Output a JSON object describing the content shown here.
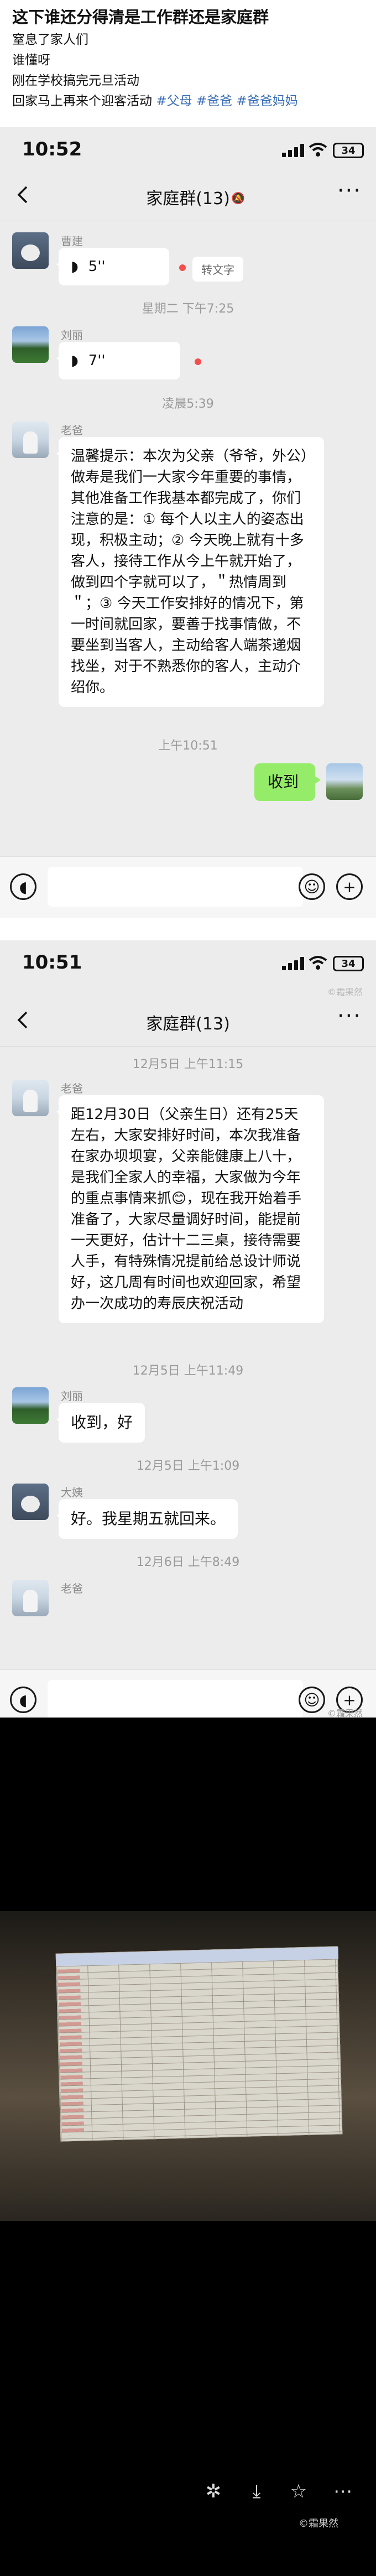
{
  "post": {
    "title": "这下谁还分得清是工作群还是家庭群",
    "lines": [
      "窒息了家人们",
      "谁懂呀",
      "刚在学校搞完元旦活动"
    ],
    "last_line_text": "回家马上再来个迎客活动 ",
    "tags": [
      "#父母",
      "#爸爸",
      "#爸爸妈妈"
    ]
  },
  "shot1": {
    "time": "10:52",
    "battery": "34",
    "chat_title": "家庭群(13)",
    "mute_icon": "🔕",
    "msg1": {
      "sender": "曹建",
      "duration": "5''",
      "to_text": "转文字"
    },
    "msg2": {
      "sender": "刘丽",
      "duration": "7''"
    },
    "ts1": "星期二 下午7:25",
    "ts2": "凌晨5:39",
    "msg3": {
      "sender": "老爸",
      "text": "温馨提示：本次为父亲（爷爷，外公）做寿是我们一大家今年重要的事情，其他准备工作我基本都完成了，你们注意的是：① 每个人以主人的姿态出现，积极主动；② 今天晚上就有十多客人，接待工作从今上午就开始了，做到四个字就可以了，＂热情周到＂；③ 今天工作安排好的情况下，第一时间就回家，要善于找事情做，不要坐到当客人，主动给客人端茶递烟找坐，对于不熟悉你的客人，主动介绍你。"
    },
    "ts3": "上午10:51",
    "msg4": {
      "text": "收到"
    }
  },
  "shot2": {
    "time": "10:51",
    "battery": "34",
    "chat_title": "家庭群(13)",
    "ts1": "12月5日 上午11:15",
    "msg1": {
      "sender": "老爸",
      "text": "距12月30日（父亲生日）还有25天左右，大家安排好时间，本次我准备在家办坝坝宴，父亲能健康上八十，是我们全家人的幸福，大家做为今年的重点事情来抓😊，现在我开始着手准备了，大家尽量调好时间，能提前一天更好，估计十二三桌，接待需要人手，有特殊情况提前给总设计师说好，这几周有时间也欢迎回家，希望办一次成功的寿辰庆祝活动"
    },
    "ts2": "12月5日 上午11:49",
    "msg2": {
      "sender": "刘丽",
      "text": "收到，好"
    },
    "ts3": "12月5日 上午1:09",
    "msg3": {
      "sender": "大姨",
      "text": "好。我星期五就回来。"
    },
    "ts4": "12月6日 上午8:49",
    "msg4": {
      "sender": "老爸"
    }
  },
  "watermark": "©霜果然",
  "icons": {
    "back": "chevron-left-icon",
    "more": "more-icon",
    "voice": "voice-wave-icon",
    "emoji": "emoji-icon",
    "plus": "plus-icon",
    "voice_input": "voice-input-icon"
  },
  "photo_actions": [
    "✲",
    "⤓",
    "☆",
    "⋯"
  ],
  "colors": {
    "my_bubble": "#95ec69",
    "tag": "#3b6fb6",
    "chat_bg": "#ececec"
  }
}
